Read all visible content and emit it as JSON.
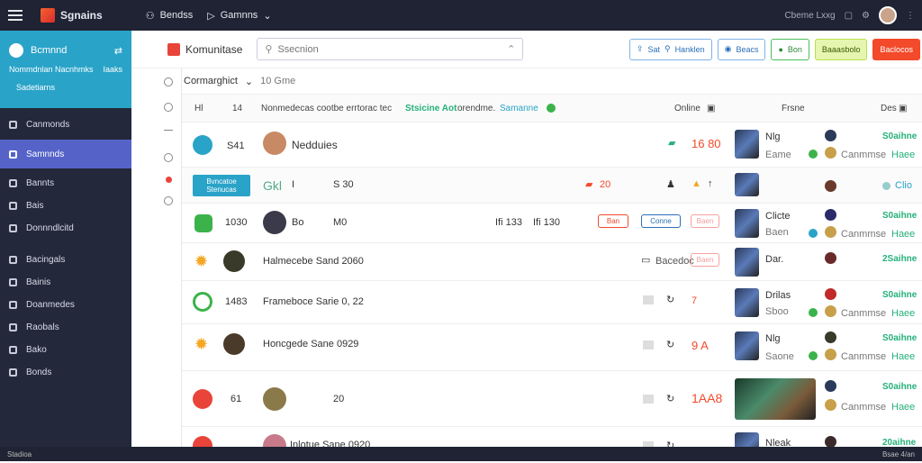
{
  "topbar": {
    "app_title": "Sgnains",
    "nav": [
      "Bendss",
      "Gamnns"
    ],
    "right_text": "Cbeme Lxxg"
  },
  "sidebar": {
    "profile_name": "Bcmnnd",
    "profile_sub": "Nommdnlan Nacnhmks",
    "profile_sub_right": "Iaaks",
    "profile_sub2": "Sadetiarns",
    "items": [
      "Canmonds",
      "Samnnds",
      "Bannts",
      "Bais",
      "Donnndlcitd",
      "Bacingals",
      "Bainis",
      "Doanmedes",
      "Raobals",
      "Bako",
      "Bonds"
    ],
    "active_index": 1
  },
  "toolbar": {
    "brand": "Komunitase",
    "search_placeholder": "Ssecnion",
    "buttons": [
      "Sat",
      "Hanklen",
      "Beacs",
      "Bon",
      "Baaasbolo",
      "Baclocos"
    ]
  },
  "filter": {
    "label": "Cormarghict",
    "value": "10 Gme"
  },
  "columns": {
    "c1": "Hl",
    "c2": "14",
    "headline_text": "Nonmedecas cootbe errtorac tec",
    "headline_green": "Stsicine Aot",
    "headline_tail": "orendme.",
    "headline_link": "Samanne",
    "online": "Online",
    "frame": "Frsne",
    "last": "Des"
  },
  "rows": [
    {
      "id": "S41",
      "name": "Nedduies",
      "stat": "16 80",
      "right_title": "Nlg",
      "right_sub": "Eame",
      "game": "Canmmse",
      "rate": "S0aihne",
      "rate_sub": "Haee"
    },
    {
      "badge": "Bvncatoe Stenucas",
      "name": "Gkl",
      "num": "I",
      "val": "S 30",
      "mid": "20",
      "right_title": "",
      "rate_sub": "Clio"
    },
    {
      "id": "1030",
      "name": "Bo",
      "num": "M0",
      "stat_left": "Ifi 133",
      "stat_mid": "Ifi 130",
      "tag1": "Ban",
      "tag2": "Conne",
      "tag3": "Baen",
      "right_title": "Clicte",
      "right_sub": "Baen",
      "game": "Canmmse",
      "rate": "S0aihne",
      "rate_sub": "Haee"
    },
    {
      "name": "Halmecebe Sand 2060",
      "tag1": "Bacedoc",
      "tag2": "Baen",
      "right_title": "Dar.",
      "rate": "2Saihne"
    },
    {
      "id": "1483",
      "name": "Frameboce Sarie 0, 22",
      "tag": "7",
      "right_title": "Drilas",
      "right_sub": "Sboo",
      "game": "Canmmse",
      "rate": "S0aihne",
      "rate_sub": "Haee"
    },
    {
      "name": "Honcgede Sane 0929",
      "tag": "9 A",
      "right_title": "Nlg",
      "right_sub": "Saone",
      "game": "Canmmse",
      "rate": "S0aihne",
      "rate_sub": "Haee"
    },
    {
      "id": "61",
      "num": "20",
      "stat": "1AA8",
      "game": "Canmmse",
      "rate": "S0aihne",
      "rate_sub": "Haee"
    },
    {
      "name": "Inlotue Sane 0920",
      "right_title": "Nleak",
      "rate": "20aihne"
    }
  ],
  "status": {
    "left": "Stadioa",
    "right": "Bsae 4/an"
  },
  "colors": {
    "accent": "#5563c9",
    "brand_red": "#e8443a",
    "teal": "#2aa3c8",
    "green": "#26b07a"
  }
}
